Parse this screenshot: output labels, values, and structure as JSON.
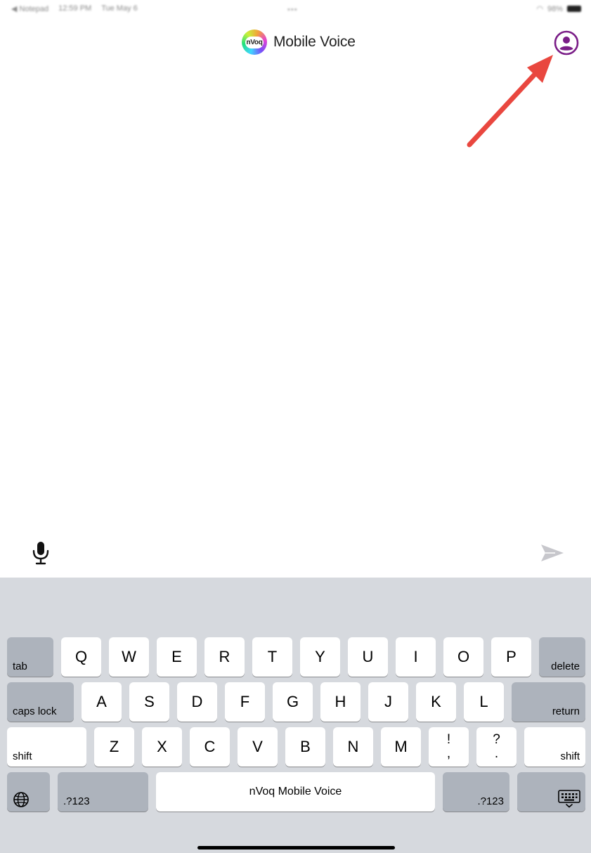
{
  "status_bar": {
    "back_app": "◀ Notepad",
    "time": "12:59 PM",
    "date": "Tue May 6",
    "center_dots": "•••",
    "battery": "98%"
  },
  "header": {
    "logo_text": "nVoq",
    "title": "Mobile Voice"
  },
  "annotation": {
    "arrow_color": "#e9473f"
  },
  "colors": {
    "profile_accent": "#7a1d87",
    "send_disabled": "#c7c7cc",
    "keyboard_bg": "#d6d9de"
  },
  "keyboard": {
    "row1": [
      "Q",
      "W",
      "E",
      "R",
      "T",
      "Y",
      "U",
      "I",
      "O",
      "P"
    ],
    "row2": [
      "A",
      "S",
      "D",
      "F",
      "G",
      "H",
      "J",
      "K",
      "L"
    ],
    "row3": [
      "Z",
      "X",
      "C",
      "V",
      "B",
      "N",
      "M"
    ],
    "tab": "tab",
    "delete": "delete",
    "caps_lock": "caps lock",
    "return": "return",
    "shift_left": "shift",
    "shift_right": "shift",
    "punct1_top": "!",
    "punct1_bottom": ",",
    "punct2_top": "?",
    "punct2_bottom": ".",
    "numbers_left": ".?123",
    "numbers_right": ".?123",
    "space": "nVoq Mobile Voice"
  }
}
